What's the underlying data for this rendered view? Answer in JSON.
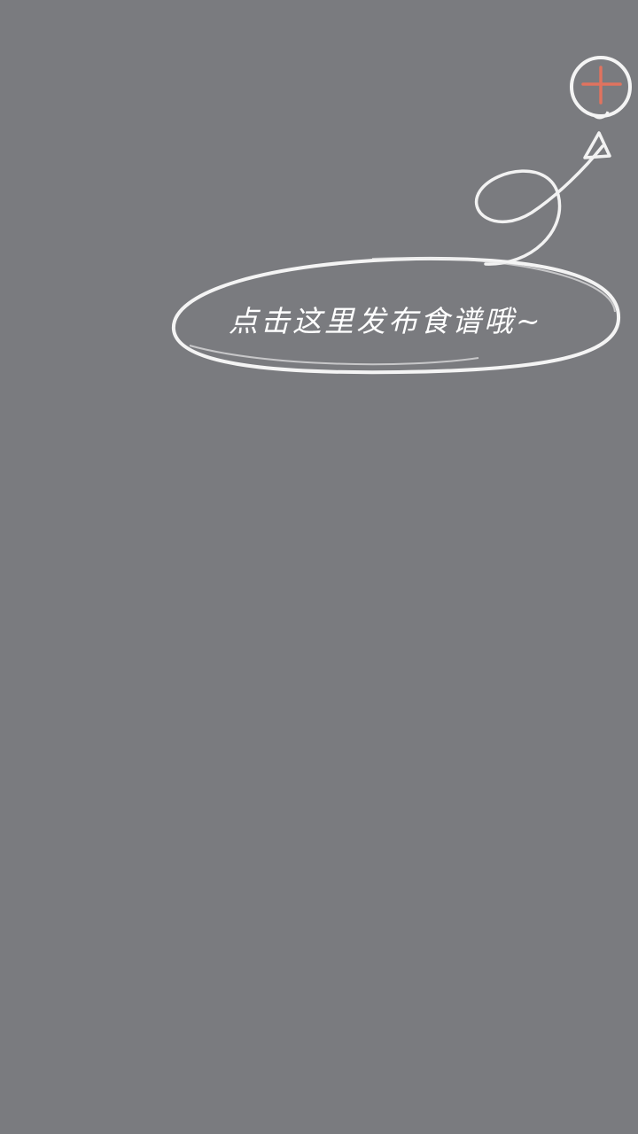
{
  "guide": {
    "hint_text": "点击这里发布食谱哦~"
  },
  "icons": {
    "add": "add-recipe-icon",
    "arrow": "guide-arrow-icon",
    "bubble": "hint-bubble-outline"
  },
  "colors": {
    "overlay": "#7a7b7f",
    "chalk": "#ffffff",
    "accent": "#e0735f"
  }
}
